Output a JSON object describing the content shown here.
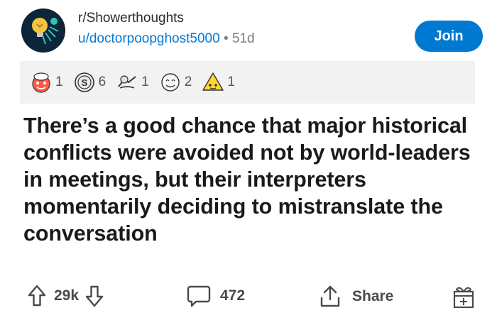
{
  "post": {
    "subreddit": "r/Showerthoughts",
    "author": "u/doctorpoopghost5000",
    "separator": "•",
    "age": "51d",
    "join_label": "Join",
    "title": "There’s a good chance that major historical conflicts were avoided not by world-leaders in meetings, but their interpreters momentarily deciding to mistranslate the conversation"
  },
  "awards": [
    {
      "icon": "wholesome-award-icon",
      "count": "1"
    },
    {
      "icon": "silver-coin-award-icon",
      "count": "6"
    },
    {
      "icon": "helpful-award-icon",
      "count": "1"
    },
    {
      "icon": "ally-award-icon",
      "count": "2"
    },
    {
      "icon": "gold-award-icon",
      "count": "1"
    }
  ],
  "actions": {
    "upvotes": "29k",
    "comments": "472",
    "share_label": "Share"
  },
  "colors": {
    "accent": "#0079d3",
    "awards_bar": "#f2f2f3",
    "subreddit_icon_bg": "#0d2538"
  }
}
